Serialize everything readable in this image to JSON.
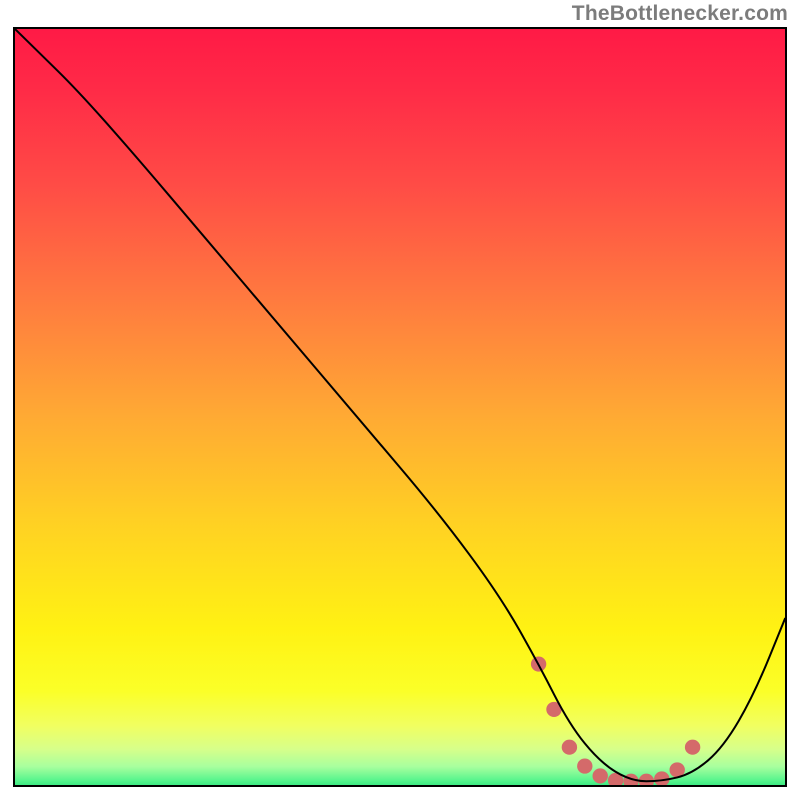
{
  "attribution": "TheBottlenecker.com",
  "chart_data": {
    "type": "line",
    "title": "",
    "xlabel": "",
    "ylabel": "",
    "xlim": [
      0,
      100
    ],
    "ylim": [
      0,
      100
    ],
    "x": [
      0,
      3,
      8,
      15,
      25,
      35,
      45,
      55,
      63,
      68,
      72,
      76,
      80,
      84,
      88,
      92,
      96,
      100
    ],
    "values": [
      100,
      97,
      92,
      84,
      72,
      60,
      48,
      36,
      25,
      16,
      8,
      3,
      0.5,
      0.5,
      1.5,
      5,
      12,
      22
    ],
    "gradient_stops": [
      {
        "pos": 0.0,
        "color": "#ff1a46"
      },
      {
        "pos": 0.08,
        "color": "#ff2b47"
      },
      {
        "pos": 0.2,
        "color": "#ff4b46"
      },
      {
        "pos": 0.35,
        "color": "#ff7a3f"
      },
      {
        "pos": 0.5,
        "color": "#ffa934"
      },
      {
        "pos": 0.65,
        "color": "#ffd322"
      },
      {
        "pos": 0.78,
        "color": "#fff213"
      },
      {
        "pos": 0.86,
        "color": "#fbff28"
      },
      {
        "pos": 0.905,
        "color": "#f1ff61"
      },
      {
        "pos": 0.935,
        "color": "#d7ff8a"
      },
      {
        "pos": 0.958,
        "color": "#a8ff9e"
      },
      {
        "pos": 0.975,
        "color": "#5bf58e"
      },
      {
        "pos": 0.99,
        "color": "#1bdf75"
      },
      {
        "pos": 1.0,
        "color": "#16d86f"
      }
    ],
    "highlight": {
      "color": "#d46a6a",
      "points_x": [
        68,
        70,
        72,
        74,
        76,
        78,
        80,
        82,
        84,
        86,
        88
      ],
      "points_y": [
        16,
        10,
        5,
        2.5,
        1.2,
        0.6,
        0.5,
        0.5,
        0.8,
        2,
        5
      ]
    }
  }
}
